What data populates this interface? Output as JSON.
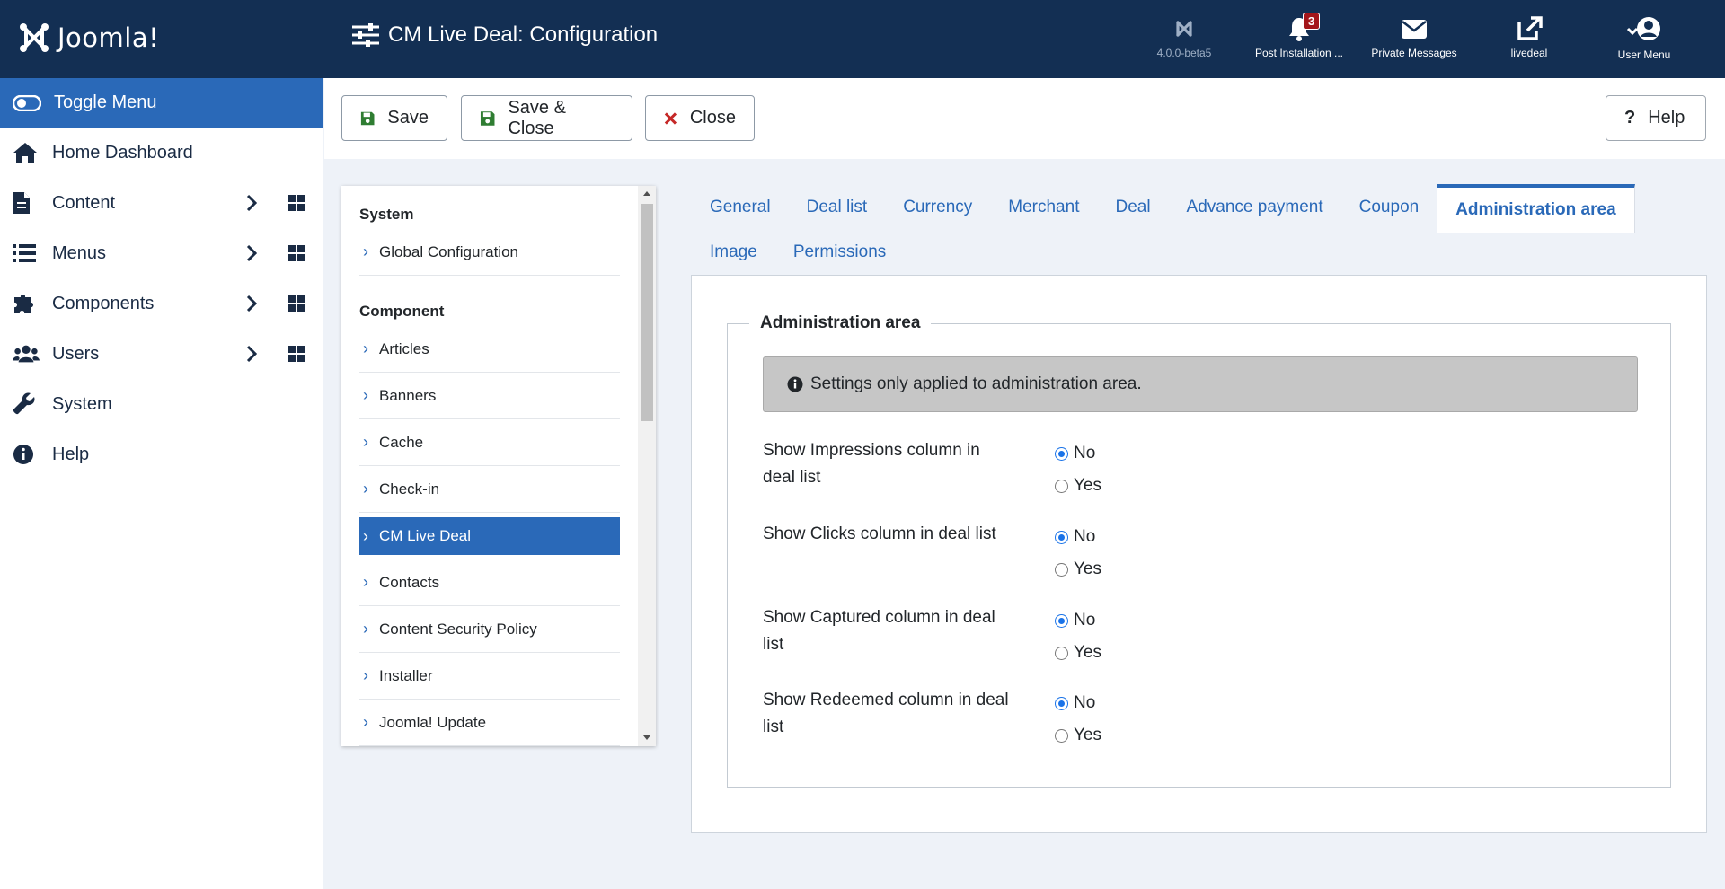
{
  "header": {
    "logo_text": "Joomla!",
    "page_title": "CM Live Deal: Configuration",
    "items": [
      {
        "label": "4.0.0-beta5"
      },
      {
        "label": "Post Installation ...",
        "badge": "3"
      },
      {
        "label": "Private Messages"
      },
      {
        "label": "livedeal"
      },
      {
        "label": "User Menu"
      }
    ]
  },
  "sidebar": {
    "toggle_label": "Toggle Menu",
    "items": [
      {
        "label": "Home Dashboard"
      },
      {
        "label": "Content"
      },
      {
        "label": "Menus"
      },
      {
        "label": "Components"
      },
      {
        "label": "Users"
      },
      {
        "label": "System"
      },
      {
        "label": "Help"
      }
    ]
  },
  "toolbar": {
    "save": "Save",
    "save_close": "Save & Close",
    "close": "Close",
    "help": "Help"
  },
  "left_panel": {
    "system_heading": "System",
    "system_items": [
      "Global Configuration"
    ],
    "component_heading": "Component",
    "component_items": [
      "Articles",
      "Banners",
      "Cache",
      "Check-in",
      "CM Live Deal",
      "Contacts",
      "Content Security Policy",
      "Installer",
      "Joomla! Update"
    ],
    "active_item": "CM Live Deal"
  },
  "tabs": {
    "row1": [
      "General",
      "Deal list",
      "Currency",
      "Merchant",
      "Deal",
      "Advance payment",
      "Coupon",
      "Administration area"
    ],
    "row2": [
      "Image",
      "Permissions"
    ],
    "active": "Administration area"
  },
  "form": {
    "legend": "Administration area",
    "alert": "Settings only applied to administration area.",
    "fields": [
      {
        "label": "Show Impressions column in deal list",
        "options": [
          "No",
          "Yes"
        ],
        "selected": "No"
      },
      {
        "label": "Show Clicks column in deal list",
        "options": [
          "No",
          "Yes"
        ],
        "selected": "No"
      },
      {
        "label": "Show Captured column in deal list",
        "options": [
          "No",
          "Yes"
        ],
        "selected": "No"
      },
      {
        "label": "Show Redeemed column in deal list",
        "options": [
          "No",
          "Yes"
        ],
        "selected": "No"
      }
    ]
  }
}
